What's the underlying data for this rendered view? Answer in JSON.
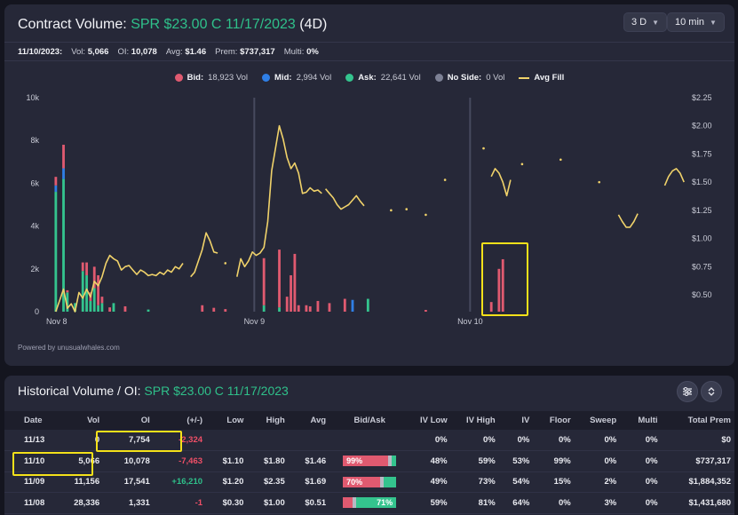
{
  "header": {
    "title_prefix": "Contract Volume:",
    "contract": "SPR $23.00 C 11/17/2023",
    "range_suffix": "(4D)",
    "range_select": "3 D",
    "interval_select": "10 min"
  },
  "infobar": {
    "date": "11/10/2023:",
    "vol_label": "Vol:",
    "vol": "5,066",
    "oi_label": "OI:",
    "oi": "10,078",
    "avg_label": "Avg:",
    "avg": "$1.46",
    "prem_label": "Prem:",
    "prem": "$737,317",
    "multi_label": "Multi:",
    "multi": "0%"
  },
  "legend": {
    "bid_label": "Bid:",
    "bid_value": "18,923 Vol",
    "mid_label": "Mid:",
    "mid_value": "2,994 Vol",
    "ask_label": "Ask:",
    "ask_value": "22,641 Vol",
    "noside_label": "No Side:",
    "noside_value": "0 Vol",
    "avgfill_label": "Avg Fill"
  },
  "colors": {
    "bid": "#e05a70",
    "mid": "#2f7fe6",
    "ask": "#34c48e",
    "noside": "#7d8195",
    "avgfill": "#f0d26a",
    "highlight": "#f4e11a"
  },
  "powered": "Powered by unusualwhales.com",
  "chart_data": {
    "type": "bar",
    "x_labels": [
      "Nov 8",
      "Nov 9",
      "Nov 10"
    ],
    "y_left_ticks": [
      "0",
      "2k",
      "4k",
      "6k",
      "8k",
      "10k"
    ],
    "y_left_range": [
      0,
      10000
    ],
    "y_right_ticks": [
      "$0.50",
      "$0.75",
      "$1.00",
      "$1.25",
      "$1.50",
      "$1.75",
      "$2.00",
      "$2.25"
    ],
    "y_right_range": [
      0.35,
      2.25
    ],
    "slots": 165,
    "session_starts": [
      0,
      54,
      110
    ],
    "bars": [
      {
        "i": 2,
        "ask": 5600,
        "mid": 300,
        "bid": 400
      },
      {
        "i": 4,
        "ask": 6200,
        "mid": 500,
        "bid": 1100
      },
      {
        "i": 5,
        "ask": 900,
        "mid": 0,
        "bid": 100
      },
      {
        "i": 7,
        "ask": 400,
        "mid": 0,
        "bid": 0
      },
      {
        "i": 9,
        "ask": 1900,
        "mid": 0,
        "bid": 400
      },
      {
        "i": 10,
        "ask": 1700,
        "mid": 0,
        "bid": 600
      },
      {
        "i": 11,
        "ask": 500,
        "mid": 0,
        "bid": 400
      },
      {
        "i": 12,
        "ask": 1100,
        "mid": 0,
        "bid": 1000
      },
      {
        "i": 13,
        "ask": 300,
        "mid": 0,
        "bid": 1400
      },
      {
        "i": 14,
        "ask": 400,
        "mid": 0,
        "bid": 300
      },
      {
        "i": 16,
        "ask": 0,
        "mid": 0,
        "bid": 200
      },
      {
        "i": 17,
        "ask": 400,
        "mid": 0,
        "bid": 0
      },
      {
        "i": 20,
        "ask": 0,
        "mid": 0,
        "bid": 250
      },
      {
        "i": 26,
        "ask": 100,
        "mid": 0,
        "bid": 0
      },
      {
        "i": 40,
        "ask": 0,
        "mid": 0,
        "bid": 300
      },
      {
        "i": 43,
        "ask": 0,
        "mid": 0,
        "bid": 180
      },
      {
        "i": 46,
        "ask": 0,
        "mid": 0,
        "bid": 120
      },
      {
        "i": 56,
        "ask": 300,
        "mid": 0,
        "bid": 2200
      },
      {
        "i": 60,
        "ask": 200,
        "mid": 0,
        "bid": 2700
      },
      {
        "i": 62,
        "ask": 0,
        "mid": 0,
        "bid": 700
      },
      {
        "i": 63,
        "ask": 0,
        "mid": 0,
        "bid": 1700
      },
      {
        "i": 64,
        "ask": 0,
        "mid": 0,
        "bid": 2700
      },
      {
        "i": 65,
        "ask": 0,
        "mid": 0,
        "bid": 300
      },
      {
        "i": 67,
        "ask": 0,
        "mid": 0,
        "bid": 300
      },
      {
        "i": 68,
        "ask": 0,
        "mid": 0,
        "bid": 250
      },
      {
        "i": 70,
        "ask": 0,
        "mid": 0,
        "bid": 500
      },
      {
        "i": 73,
        "ask": 0,
        "mid": 0,
        "bid": 400
      },
      {
        "i": 77,
        "ask": 0,
        "mid": 0,
        "bid": 600
      },
      {
        "i": 79,
        "ask": 0,
        "mid": 550,
        "bid": 0
      },
      {
        "i": 83,
        "ask": 600,
        "mid": 0,
        "bid": 0
      },
      {
        "i": 98,
        "ask": 0,
        "mid": 0,
        "bid": 80
      },
      {
        "i": 115,
        "ask": 0,
        "mid": 0,
        "bid": 450
      },
      {
        "i": 117,
        "ask": 0,
        "mid": 0,
        "bid": 2000
      },
      {
        "i": 118,
        "ask": 0,
        "mid": 0,
        "bid": 2450
      }
    ],
    "avg_fill_segments": [
      [
        [
          2,
          0.35
        ],
        [
          3,
          0.45
        ],
        [
          4,
          0.55
        ],
        [
          5,
          0.38
        ],
        [
          6,
          0.42
        ],
        [
          7,
          0.35
        ],
        [
          8,
          0.52
        ],
        [
          9,
          0.47
        ],
        [
          10,
          0.55
        ],
        [
          11,
          0.48
        ],
        [
          12,
          0.62
        ],
        [
          13,
          0.58
        ],
        [
          14,
          0.66
        ],
        [
          15,
          0.78
        ],
        [
          16,
          0.85
        ],
        [
          17,
          0.82
        ],
        [
          18,
          0.8
        ],
        [
          19,
          0.72
        ],
        [
          20,
          0.75
        ],
        [
          21,
          0.76
        ],
        [
          22,
          0.72
        ],
        [
          23,
          0.68
        ],
        [
          24,
          0.72
        ],
        [
          25,
          0.7
        ],
        [
          26,
          0.67
        ],
        [
          27,
          0.68
        ],
        [
          28,
          0.67
        ],
        [
          29,
          0.7
        ],
        [
          30,
          0.68
        ],
        [
          31,
          0.72
        ],
        [
          32,
          0.7
        ],
        [
          33,
          0.75
        ],
        [
          34,
          0.73
        ],
        [
          35,
          0.78
        ]
      ],
      [
        [
          37,
          0.66
        ],
        [
          38,
          0.7
        ],
        [
          39,
          0.8
        ],
        [
          40,
          0.9
        ],
        [
          41,
          1.05
        ],
        [
          42,
          0.98
        ],
        [
          43,
          0.88
        ],
        [
          44,
          0.87
        ]
      ],
      [
        [
          46,
          0.78
        ]
      ],
      [
        [
          49,
          0.66
        ],
        [
          50,
          0.82
        ],
        [
          51,
          0.75
        ],
        [
          52,
          0.8
        ],
        [
          53,
          0.88
        ],
        [
          54,
          0.85
        ],
        [
          55,
          0.87
        ],
        [
          56,
          0.92
        ],
        [
          57,
          1.15
        ],
        [
          58,
          1.6
        ],
        [
          59,
          1.8
        ],
        [
          60,
          2.0
        ],
        [
          61,
          1.88
        ],
        [
          62,
          1.72
        ],
        [
          63,
          1.62
        ],
        [
          64,
          1.67
        ],
        [
          65,
          1.58
        ],
        [
          66,
          1.4
        ],
        [
          67,
          1.41
        ],
        [
          68,
          1.45
        ],
        [
          69,
          1.42
        ],
        [
          70,
          1.43
        ],
        [
          71,
          1.4
        ]
      ],
      [
        [
          72,
          1.44
        ],
        [
          73,
          1.4
        ],
        [
          74,
          1.36
        ],
        [
          75,
          1.3
        ],
        [
          76,
          1.26
        ],
        [
          77,
          1.28
        ],
        [
          78,
          1.3
        ],
        [
          79,
          1.34
        ],
        [
          80,
          1.38
        ],
        [
          81,
          1.33
        ],
        [
          82,
          1.29
        ]
      ],
      [
        [
          89,
          1.25
        ]
      ],
      [
        [
          93,
          1.26
        ]
      ],
      [
        [
          98,
          1.21
        ]
      ],
      [
        [
          103,
          1.52
        ]
      ],
      [
        [
          113,
          1.8
        ]
      ],
      [
        [
          115,
          1.55
        ],
        [
          116,
          1.62
        ],
        [
          117,
          1.58
        ],
        [
          118,
          1.5
        ],
        [
          119,
          1.38
        ],
        [
          120,
          1.52
        ]
      ],
      [
        [
          123,
          1.66
        ]
      ],
      [
        [
          133,
          1.7
        ]
      ],
      [
        [
          143,
          1.5
        ]
      ],
      [
        [
          148,
          1.21
        ],
        [
          149,
          1.15
        ],
        [
          150,
          1.1
        ],
        [
          151,
          1.1
        ],
        [
          152,
          1.15
        ],
        [
          153,
          1.22
        ]
      ],
      [
        [
          160,
          1.47
        ],
        [
          161,
          1.55
        ],
        [
          162,
          1.6
        ],
        [
          163,
          1.62
        ],
        [
          164,
          1.58
        ],
        [
          165,
          1.5
        ]
      ]
    ]
  },
  "historical": {
    "title_prefix": "Historical Volume / OI:",
    "contract": "SPR $23.00 C 11/17/2023",
    "columns": [
      "Date",
      "Vol",
      "OI",
      "(+/-)",
      "Low",
      "High",
      "Avg",
      "Bid/Ask",
      "IV Low",
      "IV High",
      "IV",
      "Floor",
      "Sweep",
      "Multi",
      "Total Prem"
    ],
    "rows": [
      {
        "date": "11/13",
        "vol": "0",
        "oi": "7,754",
        "change": "-2,324",
        "change_sign": "neg",
        "low": "",
        "high": "",
        "avg": "",
        "bid_pct": 0,
        "mid_pct": 0,
        "ba_label": "",
        "iv_low": "0%",
        "iv_high": "0%",
        "iv": "0%",
        "floor": "0%",
        "sweep": "0%",
        "multi": "0%",
        "prem": "$0"
      },
      {
        "date": "11/10",
        "vol": "5,066",
        "oi": "10,078",
        "change": "-7,463",
        "change_sign": "neg",
        "low": "$1.10",
        "high": "$1.80",
        "avg": "$1.46",
        "bid_pct": 0.84,
        "mid_pct": 0.08,
        "ba_label": "99%",
        "iv_low": "48%",
        "iv_high": "59%",
        "iv": "53%",
        "floor": "99%",
        "sweep": "0%",
        "multi": "0%",
        "prem": "$737,317"
      },
      {
        "date": "11/09",
        "vol": "11,156",
        "oi": "17,541",
        "change": "+16,210",
        "change_sign": "pos",
        "low": "$1.20",
        "high": "$2.35",
        "avg": "$1.69",
        "bid_pct": 0.7,
        "mid_pct": 0.06,
        "ba_label": "70%",
        "iv_low": "49%",
        "iv_high": "73%",
        "iv": "54%",
        "floor": "15%",
        "sweep": "2%",
        "multi": "0%",
        "prem": "$1,884,352"
      },
      {
        "date": "11/08",
        "vol": "28,336",
        "oi": "1,331",
        "change": "-1",
        "change_sign": "neg",
        "low": "$0.30",
        "high": "$1.00",
        "avg": "$0.51",
        "bid_pct": 0.18,
        "mid_pct": 0.06,
        "ba_label": "71%",
        "iv_low": "59%",
        "iv_high": "81%",
        "iv": "64%",
        "floor": "0%",
        "sweep": "3%",
        "multi": "0%",
        "prem": "$1,431,680"
      }
    ]
  }
}
